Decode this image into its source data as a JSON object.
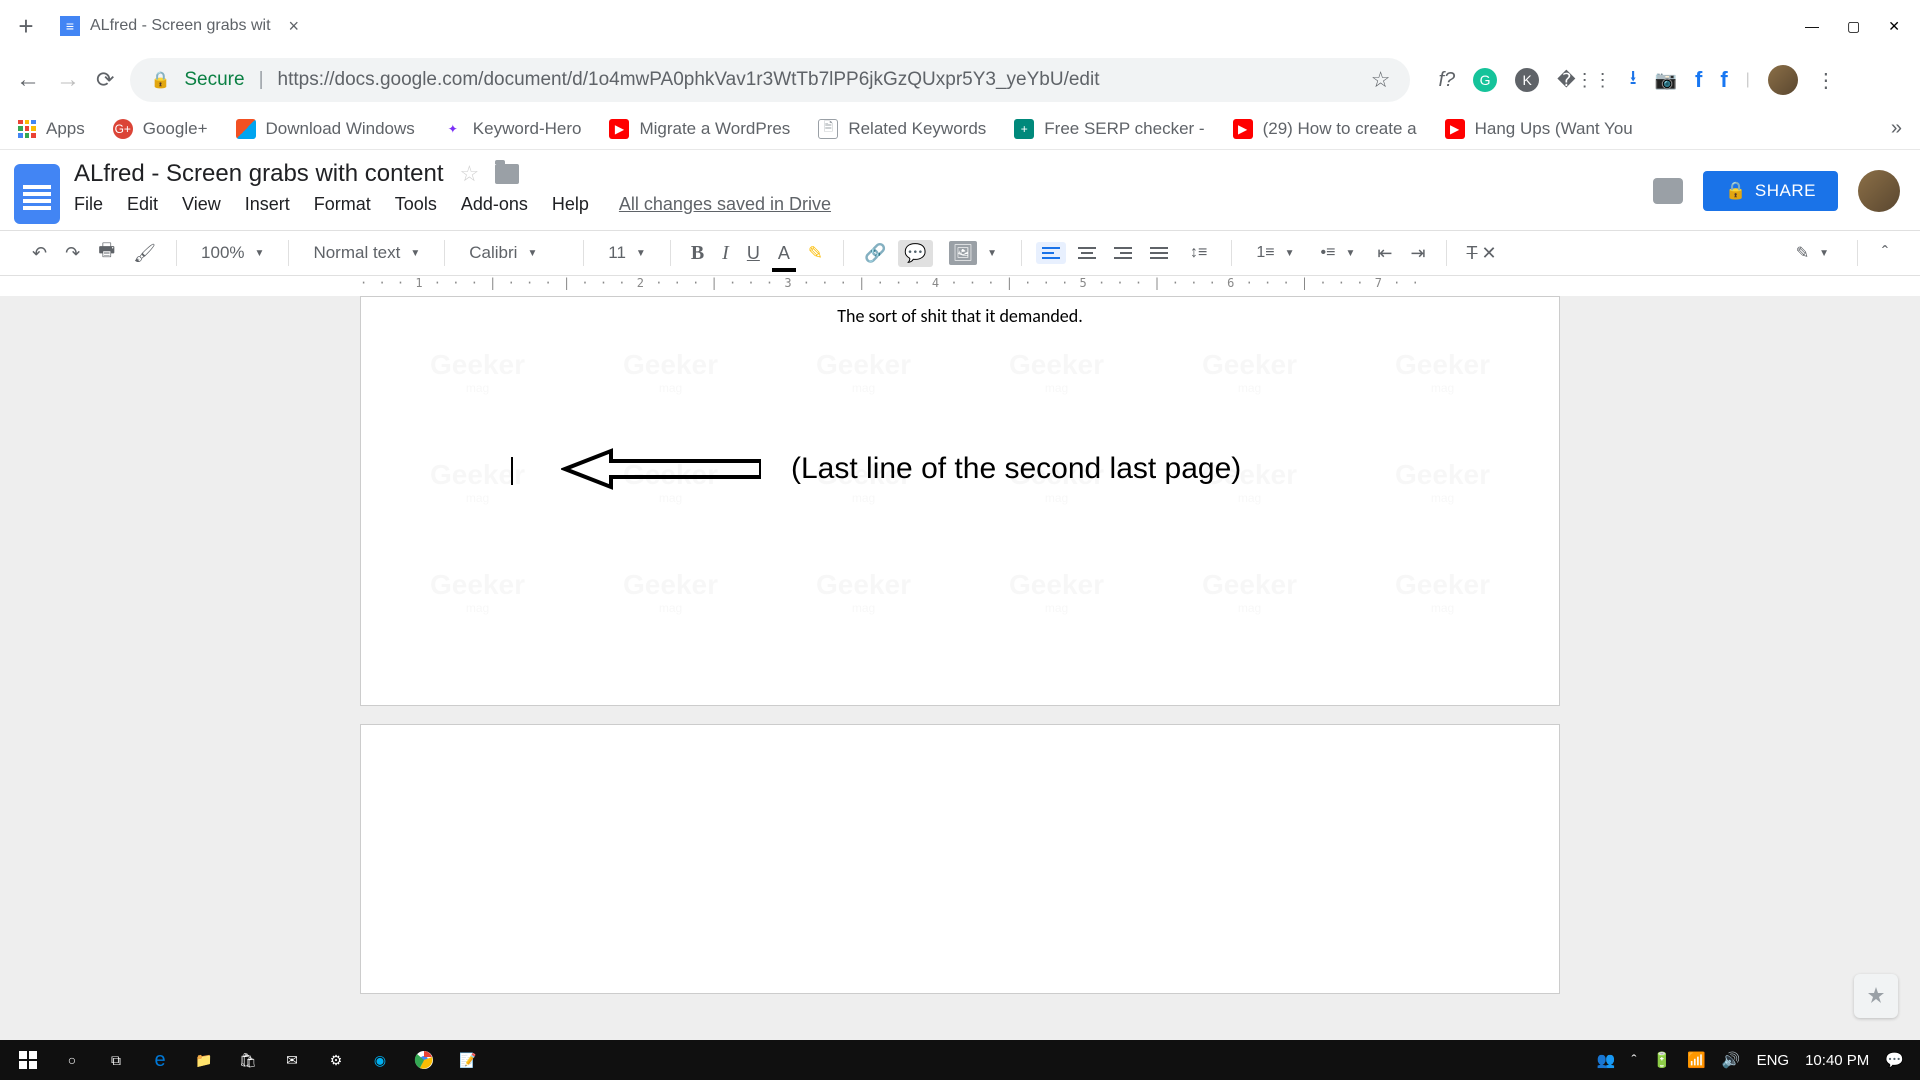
{
  "browser": {
    "tab_title": "ALfred - Screen grabs wit",
    "url": "https://docs.google.com/document/d/1o4mwPA0phkVav1r3WtTb7lPP6jkGzQUxpr5Y3_yeYbU/edit",
    "secure_label": "Secure",
    "bookmarks": {
      "apps": "Apps",
      "items": [
        {
          "label": "Google+",
          "color": "#db4437"
        },
        {
          "label": "Download Windows",
          "color": "#00a4ef"
        },
        {
          "label": "Keyword-Hero",
          "color": "#7b2ff7"
        },
        {
          "label": "Migrate a WordPres",
          "color": "#ff0000"
        },
        {
          "label": "Related Keywords",
          "color": "#9aa0a6"
        },
        {
          "label": "Free SERP checker -",
          "color": "#00897b"
        },
        {
          "label": "(29) How to create a",
          "color": "#ff0000"
        },
        {
          "label": "Hang Ups (Want You",
          "color": "#ff0000"
        }
      ]
    }
  },
  "docs": {
    "title": "ALfred - Screen grabs with content",
    "menus": [
      "File",
      "Edit",
      "View",
      "Insert",
      "Format",
      "Tools",
      "Add-ons",
      "Help"
    ],
    "save_status": "All changes saved in Drive",
    "share_label": "SHARE",
    "toolbar": {
      "zoom": "100%",
      "style": "Normal text",
      "font": "Calibri",
      "size": "11"
    },
    "ruler_marks": [
      "1",
      "2",
      "3",
      "4",
      "5",
      "6",
      "7"
    ],
    "document_line": "The sort of shit that it demanded.",
    "annotation_text": "(Last line of the second last page)",
    "watermark_text": "Geeker",
    "watermark_sub": "mag"
  },
  "taskbar": {
    "lang": "ENG",
    "time": "10:40 PM"
  }
}
